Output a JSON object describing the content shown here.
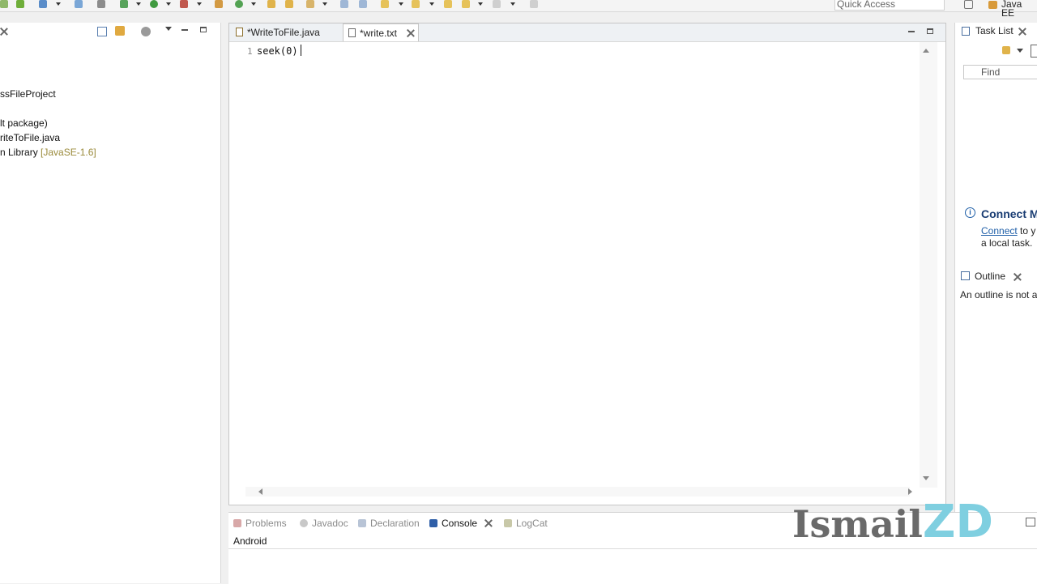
{
  "toolbar": {
    "quick_access_placeholder": "Quick Access",
    "perspective_label": "Java EE"
  },
  "left_panel": {
    "tree": [
      {
        "label": "ssFileProject"
      },
      {
        "label": "lt package)"
      },
      {
        "label": "riteToFile.java"
      },
      {
        "label": "n Library",
        "decoration": "[JavaSE-1.6]"
      }
    ]
  },
  "editor": {
    "tabs": [
      {
        "label": "*WriteToFile.java",
        "active": false
      },
      {
        "label": "*write.txt",
        "active": true
      }
    ],
    "lines": [
      {
        "number": "1",
        "text": "seek(0)"
      }
    ]
  },
  "right_panel": {
    "task_list_title": "Task List",
    "find_label": "Find",
    "connect_title": "Connect My",
    "connect_link": "Connect",
    "connect_text_1": "to y",
    "connect_text_2": "a local task.",
    "outline_title": "Outline",
    "outline_text": "An outline is not a"
  },
  "bottom_panel": {
    "tabs": [
      {
        "label": "Problems",
        "active": false
      },
      {
        "label": "Javadoc",
        "active": false
      },
      {
        "label": "Declaration",
        "active": false
      },
      {
        "label": "Console",
        "active": true
      },
      {
        "label": "LogCat",
        "active": false
      }
    ],
    "console_name": "Android"
  },
  "watermark": {
    "part1": "Ismail",
    "part2": "ZD"
  },
  "colors": {
    "accent_link": "#1f5fa8",
    "tree_decoration": "#9a8a3a",
    "watermark_gray": "#6a6a6a",
    "watermark_cyan": "#7fcfe0"
  }
}
